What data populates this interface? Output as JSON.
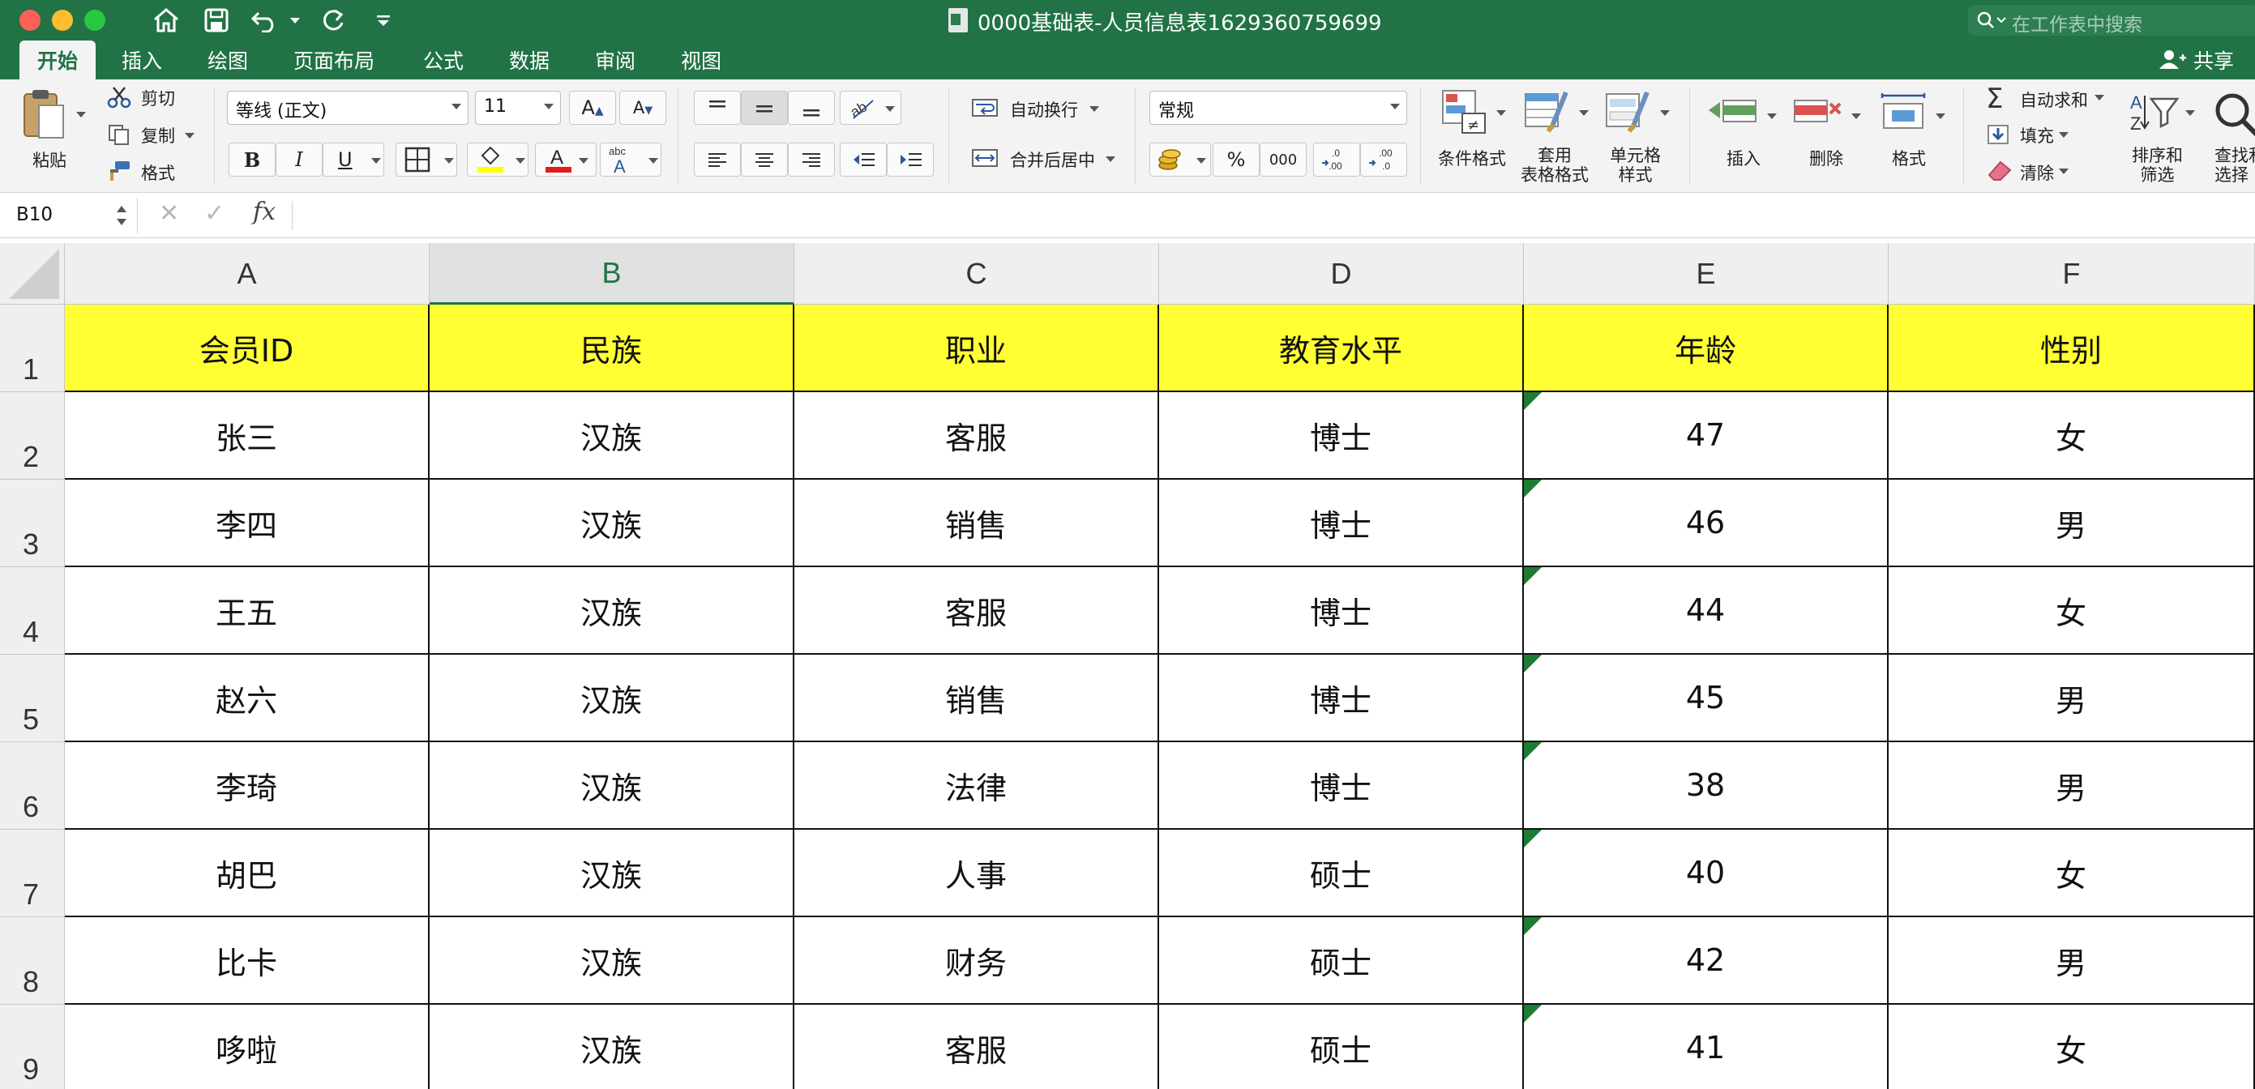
{
  "titlebar": {
    "title": "0000基础表-人员信息表1629360759699",
    "search_placeholder": "在工作表中搜索"
  },
  "tabs": [
    "开始",
    "插入",
    "绘图",
    "页面布局",
    "公式",
    "数据",
    "审阅",
    "视图"
  ],
  "active_tab": "开始",
  "share_label": "共享",
  "ribbon": {
    "paste": "粘贴",
    "cut": "剪切",
    "copy": "复制",
    "format_painter": "格式",
    "font_name": "等线 (正文)",
    "font_size": "11",
    "bold": "B",
    "italic": "I",
    "underline": "U",
    "wrap_text": "自动换行",
    "merge_center": "合并后居中",
    "number_format": "常规",
    "percent": "%",
    "thousands": "000",
    "conditional_format": "条件格式",
    "table_format": "套用\n表格格式",
    "cell_style": "单元格\n样式",
    "insert": "插入",
    "delete": "删除",
    "format": "格式",
    "autosum": "自动求和",
    "fill": "填充",
    "clear": "清除",
    "sort_filter": "排序和\n筛选",
    "find_select": "查找和\n选择"
  },
  "formula_bar": {
    "name_box": "B10",
    "fx": "fx",
    "content": ""
  },
  "grid": {
    "columns": [
      "A",
      "B",
      "C",
      "D",
      "E",
      "F"
    ],
    "selected_column": "B",
    "row_numbers": [
      "1",
      "2",
      "3",
      "4",
      "5",
      "6",
      "7",
      "8",
      "9"
    ],
    "header_fill": "#ffff33",
    "rows": [
      [
        "会员ID",
        "民族",
        "职业",
        "教育水平",
        "年龄",
        "性别"
      ],
      [
        "张三",
        "汉族",
        "客服",
        "博士",
        "47",
        "女"
      ],
      [
        "李四",
        "汉族",
        "销售",
        "博士",
        "46",
        "男"
      ],
      [
        "王五",
        "汉族",
        "客服",
        "博士",
        "44",
        "女"
      ],
      [
        "赵六",
        "汉族",
        "销售",
        "博士",
        "45",
        "男"
      ],
      [
        "李琦",
        "汉族",
        "法律",
        "博士",
        "38",
        "男"
      ],
      [
        "胡巴",
        "汉族",
        "人事",
        "硕士",
        "40",
        "女"
      ],
      [
        "比卡",
        "汉族",
        "财务",
        "硕士",
        "42",
        "男"
      ],
      [
        "哆啦",
        "汉族",
        "客服",
        "硕士",
        "41",
        "女"
      ]
    ],
    "number_as_text_column": 4
  }
}
